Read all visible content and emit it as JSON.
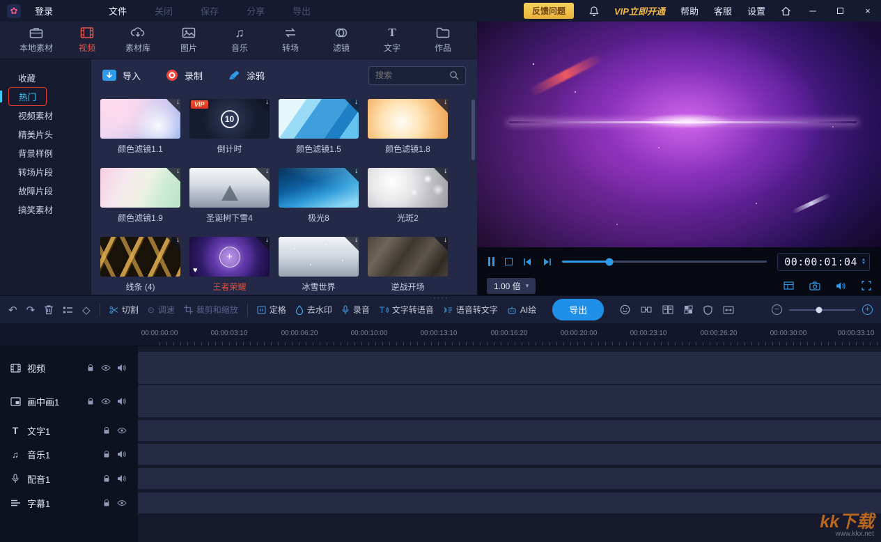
{
  "colors": {
    "accent_blue": "#2F9AE8",
    "active_red": "#E8554C",
    "highlight_cyan": "#3EC8F6",
    "vip_gold": "#F0B64A",
    "feedback_yellow": "#EAB23A",
    "selected_label_red": "#E8503C"
  },
  "titlebar": {
    "login": "登录",
    "menu": [
      "文件",
      "关闭",
      "保存",
      "分享",
      "导出"
    ],
    "feedback": "反馈问题",
    "vip": "VIP立即开通",
    "help": "帮助",
    "support": "客服",
    "settings": "设置"
  },
  "tabs": [
    {
      "label": "本地素材",
      "active": false
    },
    {
      "label": "视频",
      "active": true
    },
    {
      "label": "素材库",
      "active": false
    },
    {
      "label": "图片",
      "active": false
    },
    {
      "label": "音乐",
      "active": false
    },
    {
      "label": "转场",
      "active": false
    },
    {
      "label": "滤镜",
      "active": false
    },
    {
      "label": "文字",
      "active": false
    },
    {
      "label": "作品",
      "active": false
    }
  ],
  "sidebar": {
    "items": [
      {
        "label": "收藏",
        "active": false
      },
      {
        "label": "热门",
        "active": true
      },
      {
        "label": "视频素材",
        "active": false
      },
      {
        "label": "精美片头",
        "active": false
      },
      {
        "label": "背景样例",
        "active": false
      },
      {
        "label": "转场片段",
        "active": false
      },
      {
        "label": "故障片段",
        "active": false
      },
      {
        "label": "搞笑素材",
        "active": false
      }
    ]
  },
  "materials": {
    "import_label": "导入",
    "record_label": "录制",
    "doodle_label": "涂鸦",
    "search_placeholder": "搜索",
    "items": [
      {
        "label": "颜色滤镜1.1"
      },
      {
        "label": "倒计时",
        "badge": "VIP",
        "number": "10"
      },
      {
        "label": "颜色滤镜1.5"
      },
      {
        "label": "颜色滤镜1.8"
      },
      {
        "label": "颜色滤镜1.9"
      },
      {
        "label": "圣诞树下雪4"
      },
      {
        "label": "极光8"
      },
      {
        "label": "光斑2"
      },
      {
        "label": "线条 (4)"
      },
      {
        "label": "王者荣耀",
        "selected": true
      },
      {
        "label": "冰雪世界"
      },
      {
        "label": "逆战开场"
      }
    ]
  },
  "preview": {
    "timecode": "00:00:01:04",
    "speed": "1.00 倍"
  },
  "toolbar": {
    "cut": "切割",
    "speed": "调速",
    "crop": "裁剪和缩放",
    "freeze": "定格",
    "remove_watermark": "去水印",
    "record_audio": "录音",
    "tts": "文字转语音",
    "stt": "语音转文字",
    "ai": "AI绘",
    "export": "导出"
  },
  "timeline": {
    "ruler": [
      "00:00:00:00",
      "00:00:03:10",
      "00:00:06:20",
      "00:00:10:00",
      "00:00:13:10",
      "00:00:16:20",
      "00:00:20:00",
      "00:00:23:10",
      "00:00:26:20",
      "00:00:30:00",
      "00:00:33:10"
    ],
    "tracks": [
      {
        "label": "视频"
      },
      {
        "label": "画中画1"
      },
      {
        "label": "文字1"
      },
      {
        "label": "音乐1"
      },
      {
        "label": "配音1"
      },
      {
        "label": "字幕1"
      }
    ]
  },
  "watermark": {
    "title": "kk下载",
    "url": "www.kkx.net"
  },
  "icons": {
    "logo": "✿",
    "undo": "↶",
    "redo": "↷",
    "keyframe": "◇",
    "speed_dial": "⊙",
    "music_note": "♫",
    "text_t": "T",
    "caret_down": "▾",
    "spin_up": "▲",
    "spin_down": "▼",
    "heart": "♥",
    "plus": "+",
    "layout_grid": "⊞",
    "minus": "−",
    "plus_sign": "+",
    "close": "×",
    "minimize": "─",
    "drag_dots": "····",
    "subtitle_lines": "≡"
  }
}
